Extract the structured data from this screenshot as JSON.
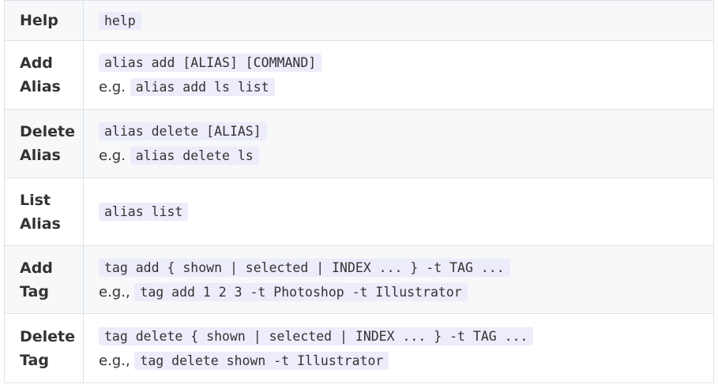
{
  "rows": [
    {
      "action": [
        "Help"
      ],
      "lines": [
        {
          "prefix": "",
          "code": "help"
        }
      ]
    },
    {
      "action": [
        "Add",
        "Alias"
      ],
      "lines": [
        {
          "prefix": "",
          "code": "alias add [ALIAS] [COMMAND]"
        },
        {
          "prefix": "e.g.",
          "code": "alias add ls list"
        }
      ]
    },
    {
      "action": [
        "Delete",
        "Alias"
      ],
      "lines": [
        {
          "prefix": "",
          "code": "alias delete [ALIAS]"
        },
        {
          "prefix": "e.g.",
          "code": "alias delete ls"
        }
      ]
    },
    {
      "action": [
        "List",
        "Alias"
      ],
      "lines": [
        {
          "prefix": "",
          "code": "alias list"
        }
      ]
    },
    {
      "action": [
        "Add",
        "Tag"
      ],
      "lines": [
        {
          "prefix": "",
          "code": "tag add { shown | selected | INDEX ... } -t TAG ..."
        },
        {
          "prefix": "e.g.,",
          "code": "tag add 1 2 3 -t Photoshop -t Illustrator"
        }
      ]
    },
    {
      "action": [
        "Delete",
        "Tag"
      ],
      "lines": [
        {
          "prefix": "",
          "code": "tag delete { shown | selected | INDEX ... } -t TAG ..."
        },
        {
          "prefix": "e.g.,",
          "code": "tag delete shown -t Illustrator"
        }
      ]
    }
  ]
}
